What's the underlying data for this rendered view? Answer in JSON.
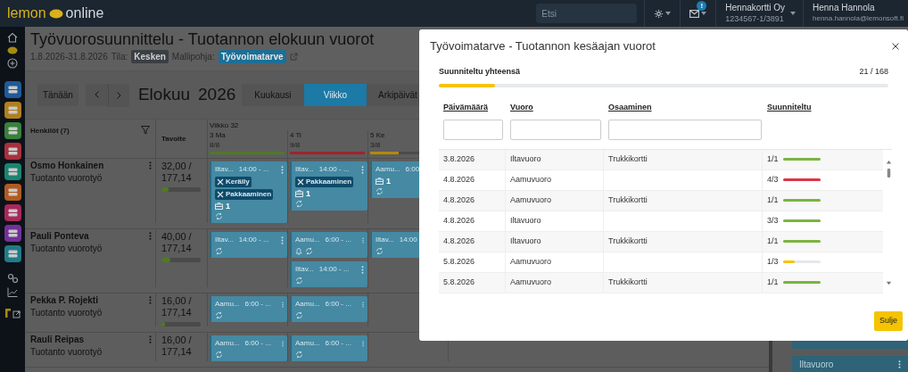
{
  "top_bar": {
    "logo": {
      "left": "lemon",
      "right": "online"
    },
    "search": {
      "placeholder": "Etsi"
    },
    "mail_badge": "!",
    "company": {
      "name": "Hennakortti Oy",
      "code": "1234567-1/3891"
    },
    "user": {
      "name": "Henna Hannola",
      "email": "henna.hannola@lemonsoft.fi"
    }
  },
  "sidebar": {
    "items": [
      {
        "kind": "home"
      },
      {
        "kind": "dot"
      },
      {
        "kind": "add"
      },
      {
        "kind": "tile",
        "color": "#1f5a9a"
      },
      {
        "kind": "tile",
        "color": "#b07f1f"
      },
      {
        "kind": "tile",
        "color": "#3a7f3e"
      },
      {
        "kind": "tile",
        "color": "#a8303d"
      },
      {
        "kind": "tile",
        "color": "#1a8470"
      },
      {
        "kind": "tile",
        "color": "#b25a20"
      },
      {
        "kind": "tile",
        "color": "#a8285b"
      },
      {
        "kind": "tile",
        "color": "#73309a"
      },
      {
        "kind": "tile",
        "color": "#1f7b88"
      },
      {
        "kind": "settings"
      },
      {
        "kind": "chart"
      },
      {
        "kind": "app-link"
      }
    ]
  },
  "page": {
    "title": "Työvuorosuunnittelu - Tuotannon elokuun vuorot",
    "date_range": "1.8.2026-31.8.2026",
    "status_label": "Tila:",
    "status": "Kesken",
    "template_label": "Mallipohja:",
    "template": "Työvoimatarve"
  },
  "toolbar": {
    "today": "Tänään",
    "month": "Elokuu",
    "year": "2026",
    "views": [
      {
        "label": "Kuukausi",
        "selected": false
      },
      {
        "label": "Viikko",
        "selected": true
      },
      {
        "label": "Arkipäivät",
        "selected": false
      }
    ]
  },
  "schedule": {
    "people_header": "Henkilöt (7)",
    "target_header": "Tavoite",
    "week": "Viikko 32",
    "days": [
      {
        "label": "3 Ma",
        "staffing": "8/8",
        "level": 1,
        "color": "#4f7a25"
      },
      {
        "label": "4 Ti",
        "staffing": "9/8",
        "level": 1,
        "color": "#a0232e"
      },
      {
        "label": "5 Ke",
        "staffing": "3/8",
        "level": 0.375,
        "color": "#b58a04"
      }
    ],
    "people": [
      {
        "name": "Osmo Honkainen",
        "role": "Tuotanto vuorotyö",
        "hours": "32,00 /",
        "target": "177,14",
        "level": 0.18,
        "shifts": [
          [
            {
              "title": "Iltav...",
              "time": "14:00 - ...",
              "skills": [
                "Keräily",
                "Pakkaaminen"
              ],
              "count": "1",
              "bell": false
            }
          ],
          [
            {
              "title": "Iltav...",
              "time": "14:00 - ...",
              "skills": [
                "Pakkaaminen"
              ],
              "count": "1",
              "bell": false
            }
          ],
          [
            {
              "title": "Aamu...",
              "time": "6:00",
              "count": "1",
              "bell": false
            }
          ]
        ]
      },
      {
        "name": "Pauli Ponteva",
        "role": "Tuotanto vuorotyö",
        "hours": "40,00 /",
        "target": "177,14",
        "level": 0.23,
        "shifts": [
          [
            {
              "title": "Iltav...",
              "time": "14:00 - ...",
              "bell": false
            }
          ],
          [
            {
              "title": "Aamu...",
              "time": "6:00 - ...",
              "bell": true
            },
            {
              "title": "Iltav...",
              "time": "14:00 - ...",
              "bell": false
            }
          ],
          [
            {
              "title": "Iltav...",
              "time": "14:00",
              "bell": false
            }
          ]
        ]
      },
      {
        "name": "Pekka P. Rojekti",
        "role": "Tuotanto vuorotyö",
        "hours": "16,00 /",
        "target": "177,14",
        "level": 0.09,
        "shifts": [
          [
            {
              "title": "Aamu...",
              "time": "6:00 - ...",
              "bell": false
            }
          ],
          [
            {
              "title": "Aamu...",
              "time": "6:00 - ...",
              "bell": false
            }
          ]
        ]
      },
      {
        "name": "Rauli Reipas",
        "role": "Tuotanto vuorotyö",
        "hours": "16,00 /",
        "target": "177,14",
        "shifts": [
          [
            {
              "title": "Aamu...",
              "time": "6:00 - ...",
              "bell": false
            }
          ],
          [
            {
              "title": "Aamu...",
              "time": "6:00 - ...",
              "bell": false
            }
          ]
        ]
      }
    ]
  },
  "lower_right_card": {
    "title": "Iltavuoro"
  },
  "modal": {
    "title": "Työvoimatarve - Tuotannon kesäajan vuorot",
    "progress": {
      "label": "Suunniteltu yhteensä",
      "reading": "21 / 168",
      "level": 0.125
    },
    "columns": [
      {
        "label": "Päivämäärä",
        "filter": true
      },
      {
        "label": "Vuoro",
        "filter": true
      },
      {
        "label": "Osaaminen",
        "filter": true
      },
      {
        "label": "Suunniteltu",
        "filter": false
      }
    ],
    "rows": [
      {
        "date": "3.8.2026",
        "shift": "Iltavuoro",
        "skill": "Trukkikortti",
        "planned": "1/1",
        "level": 1,
        "color": "#7cb342"
      },
      {
        "date": "4.8.2026",
        "shift": "Aamuvuoro",
        "planned": "4/3",
        "level": 1,
        "color": "#dc3545"
      },
      {
        "date": "4.8.2026",
        "shift": "Aamuvuoro",
        "skill": "Trukkikortti",
        "planned": "1/1",
        "level": 1,
        "color": "#7cb342"
      },
      {
        "date": "4.8.2026",
        "shift": "Iltavuoro",
        "planned": "3/3",
        "level": 1,
        "color": "#7cb342"
      },
      {
        "date": "4.8.2026",
        "shift": "Iltavuoro",
        "skill": "Trukkikortti",
        "planned": "1/1",
        "level": 1,
        "color": "#7cb342"
      },
      {
        "date": "5.8.2026",
        "shift": "Aamuvuoro",
        "planned": "1/3",
        "level": 0.33,
        "color": "#f5c400"
      },
      {
        "date": "5.8.2026",
        "shift": "Aamuvuoro",
        "skill": "Trukkikortti",
        "planned": "1/1",
        "level": 1,
        "color": "#7cb342"
      }
    ],
    "button": "Sulje"
  }
}
